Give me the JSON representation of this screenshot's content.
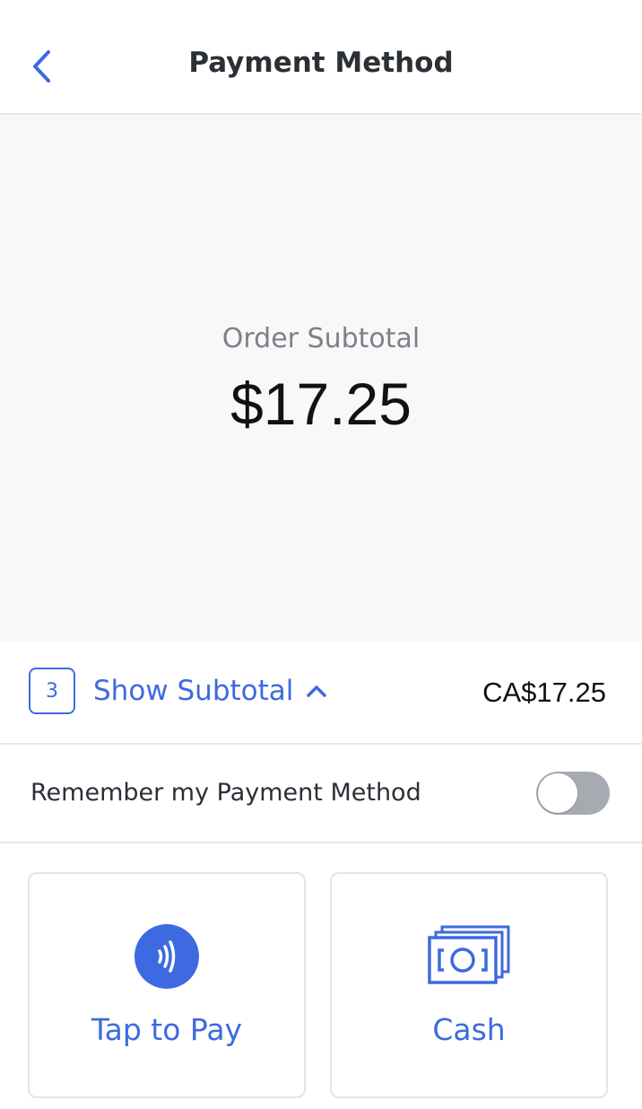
{
  "header": {
    "title": "Payment Method"
  },
  "summary": {
    "label": "Order Subtotal",
    "amount": "$17.25"
  },
  "subtotal_row": {
    "item_count": "3",
    "toggle_label": "Show Subtotal",
    "total": "CA$17.25"
  },
  "remember": {
    "label": "Remember my Payment Method",
    "enabled": false
  },
  "payment_methods": [
    {
      "label": "Tap to Pay",
      "icon": "contactless-icon"
    },
    {
      "label": "Cash",
      "icon": "cash-icon"
    }
  ],
  "colors": {
    "accent": "#3d6ae0",
    "toggle_off": "#a7abb1",
    "summary_background": "#f8f8f9"
  }
}
